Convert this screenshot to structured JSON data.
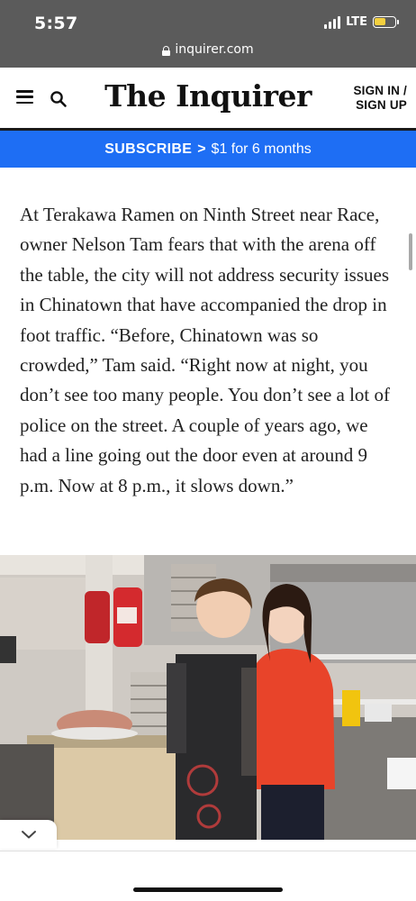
{
  "status_bar": {
    "time": "5:57",
    "network": "LTE",
    "battery_level": 0.55,
    "battery_color": "#f4d03f"
  },
  "browser": {
    "url": "inquirer.com",
    "lock_icon": "lock-icon"
  },
  "header": {
    "menu_icon": "hamburger-menu-icon",
    "search_icon": "search-icon",
    "logo": "The Inquirer",
    "signin_line1": "SIGN IN /",
    "signin_line2": "SIGN UP"
  },
  "subscribe": {
    "label": "SUBSCRIBE",
    "chevron": ">",
    "offer": "$1 for 6 months",
    "color": "#1e6ef4"
  },
  "article": {
    "paragraph": "At Terakawa Ramen on Ninth Street near Race, owner Nelson Tam fears that with the arena off the table, the city will not address security issues in Chinatown that have accompanied the drop in foot traffic. “Before, Chinatown was so crowded,” Tam said. “Right now at night, you don’t see too many people. You don’t see a lot of police on the street. A couple of years ago, we had a line going out the door even at around 9 p.m. Now at 8 p.m., it slows down.”"
  },
  "photo": {
    "subject": "two women standing in a restaurant kitchen"
  },
  "collapse_icon": "chevron-down-icon"
}
